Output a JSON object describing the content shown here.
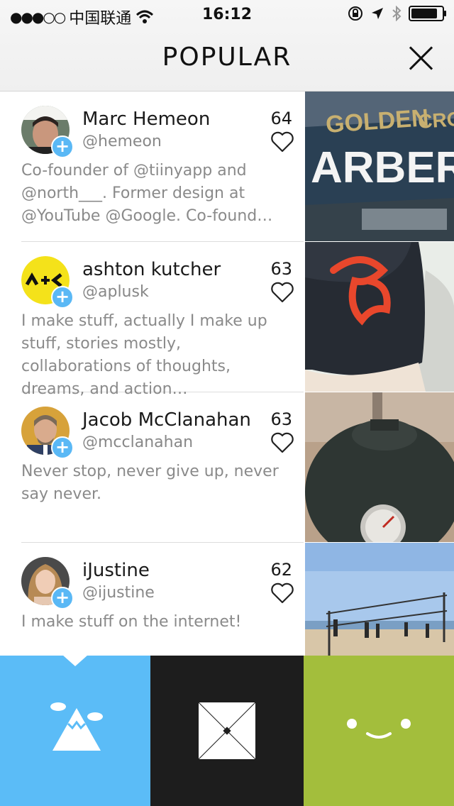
{
  "status_bar": {
    "carrier": "中国联通",
    "time": "16:12",
    "battery_level": 0.9
  },
  "header": {
    "title": "POPULAR"
  },
  "users": [
    {
      "name": "Marc Hemeon",
      "handle": "@hemeon",
      "likes": "64",
      "bio": "Co-founder of @tiinyapp and @north___. Former design at @YouTube @Google.  Co-found…"
    },
    {
      "name": "ashton kutcher",
      "handle": "@aplusk",
      "likes": "63",
      "bio": "I make stuff, actually I make up stuff, stories mostly, collaborations of thoughts, dreams, and action…"
    },
    {
      "name": "Jacob McClanahan",
      "handle": "@mcclanahan",
      "likes": "63",
      "bio": "Never stop, never give up, never say never."
    },
    {
      "name": "iJustine",
      "handle": "@ijustine",
      "likes": "62",
      "bio": "I make stuff on the internet!"
    }
  ],
  "thumb_texts": {
    "golden": "GOLDEN",
    "crow": "CROW",
    "arbers": "ARBERS"
  },
  "tabs": [
    {
      "icon": "mountain-cloud-icon",
      "color": "#5bbcf7"
    },
    {
      "icon": "envelope-icon",
      "color": "#1d1d1d"
    },
    {
      "icon": "smiley-face-icon",
      "color": "#a3be3c"
    }
  ]
}
